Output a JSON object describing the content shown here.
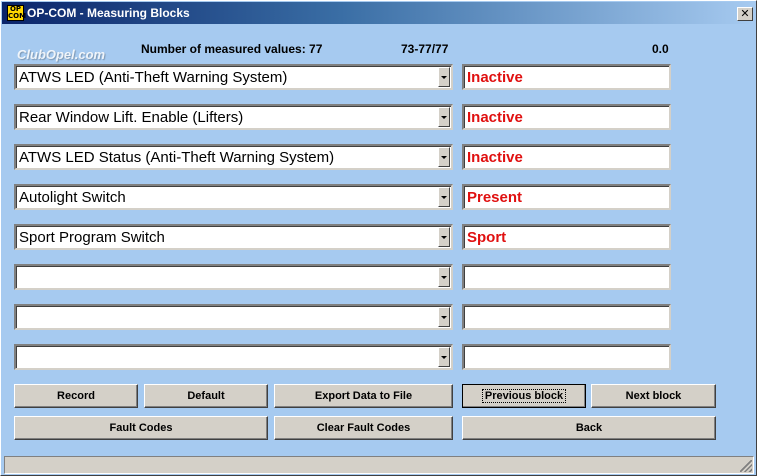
{
  "window": {
    "title": "OP-COM - Measuring Blocks",
    "icon_label": "OP COM",
    "watermark": "ClubOpel.com",
    "close_symbol": "✕"
  },
  "header": {
    "measured_label": "Number of measured values: 77",
    "range": "73-77/77",
    "value": "0.0"
  },
  "rows": [
    {
      "name": "ATWS LED (Anti-Theft Warning System)",
      "value": "Inactive"
    },
    {
      "name": "Rear Window Lift. Enable (Lifters)",
      "value": "Inactive"
    },
    {
      "name": "ATWS LED Status (Anti-Theft Warning System)",
      "value": "Inactive"
    },
    {
      "name": "Autolight Switch",
      "value": "Present"
    },
    {
      "name": "Sport Program Switch",
      "value": "Sport"
    },
    {
      "name": "",
      "value": ""
    },
    {
      "name": "",
      "value": ""
    },
    {
      "name": "",
      "value": ""
    }
  ],
  "buttons": {
    "record": "Record",
    "default": "Default",
    "export": "Export Data to File",
    "previous": "Previous block",
    "next": "Next block",
    "fault_codes": "Fault Codes",
    "clear_fault_codes": "Clear Fault Codes",
    "back": "Back"
  },
  "colors": {
    "background": "#a6caf0",
    "value_text": "#e01010",
    "button_face": "#d4d0c8"
  }
}
